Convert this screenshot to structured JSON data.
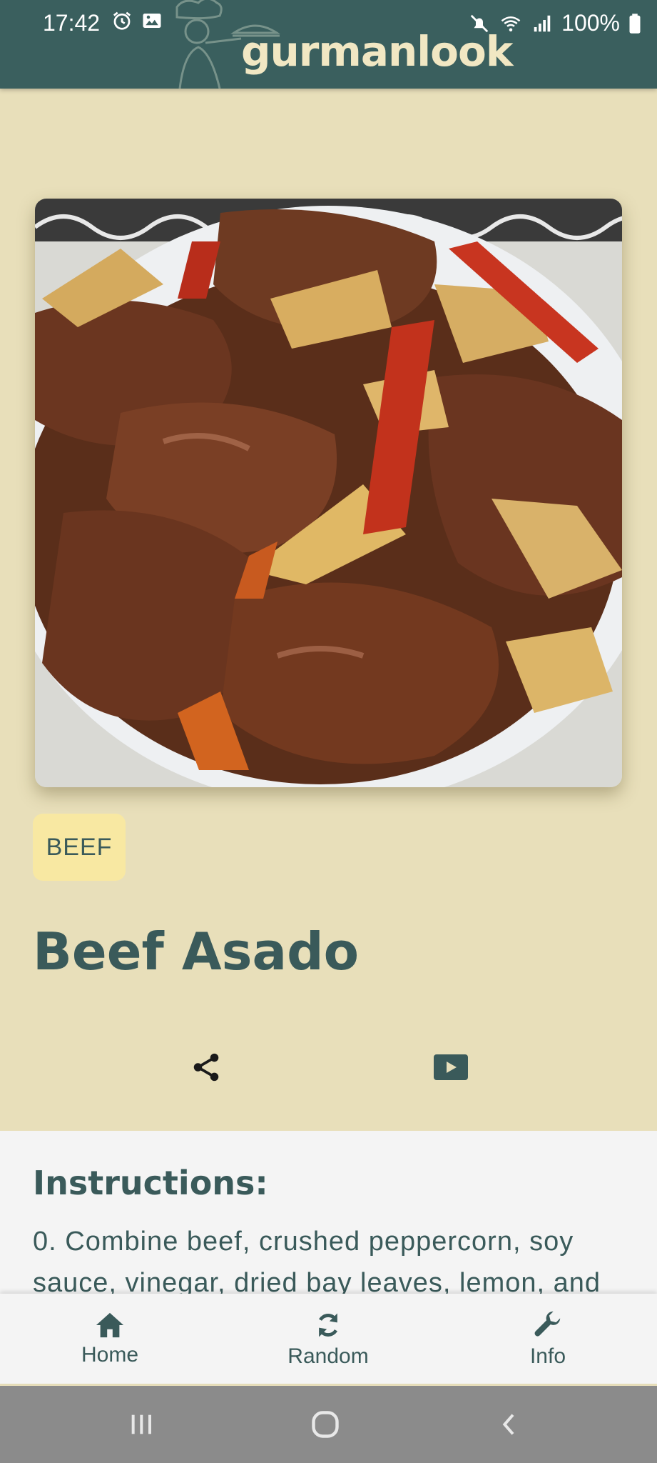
{
  "status_bar": {
    "time": "17:42",
    "battery": "100%",
    "icons_left": [
      "alarm-icon",
      "image-icon"
    ],
    "icons_right": [
      "mute-icon",
      "wifi-icon",
      "signal-icon",
      "battery-icon"
    ]
  },
  "app": {
    "logo_text": "gurmanlook",
    "bar_color": "#3a5f5e",
    "accent_color": "#3a5a5a",
    "background_color": "#e8dfba"
  },
  "recipe": {
    "category": "BEEF",
    "title": "Beef Asado",
    "actions": [
      {
        "icon": "share-icon"
      },
      {
        "icon": "youtube-play-icon"
      }
    ]
  },
  "instructions": {
    "heading": "Instructions:",
    "text": "0.  Combine beef, crushed peppercorn, soy sauce, vinegar, dried bay leaves, lemon, and"
  },
  "bottom_nav": {
    "items": [
      {
        "label": "Home",
        "icon": "home-icon"
      },
      {
        "label": "Random",
        "icon": "refresh-icon"
      },
      {
        "label": "Info",
        "icon": "wrench-icon"
      }
    ]
  },
  "system_nav": [
    "recent-apps-icon",
    "home-circle-icon",
    "back-icon"
  ]
}
